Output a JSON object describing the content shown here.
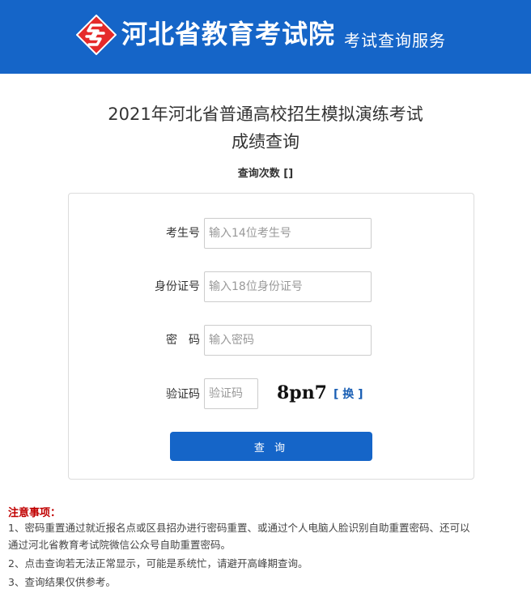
{
  "header": {
    "logo_icon": "exam-logo-icon",
    "site_name": "河北省教育考试院",
    "site_subtitle": "考试查询服务",
    "background_color": "#1565c8",
    "logo_color": "#e52a2a"
  },
  "page": {
    "title_line1": "2021年河北省普通高校招生模拟演练考试",
    "title_line2": "成绩查询",
    "query_count": "查询次数 []"
  },
  "form": {
    "exam_number": {
      "label": "考生号",
      "placeholder": "输入14位考生号",
      "value": ""
    },
    "id_number": {
      "label": "身份证号",
      "placeholder": "输入18位身份证号",
      "value": ""
    },
    "password": {
      "label": "密　码",
      "placeholder": "输入密码",
      "value": ""
    },
    "captcha": {
      "label": "验证码",
      "placeholder": "验证码",
      "value": "",
      "image_text": "8pn7",
      "refresh_open": "[",
      "refresh_label": "换",
      "refresh_close": "]"
    },
    "submit_label": "查 询",
    "accent_color": "#1565c8"
  },
  "notice": {
    "title": "注意事项：",
    "items": [
      "1、密码重置通过就近报名点或区县招办进行密码重置、或通过个人电脑人脸识别自助重置密码、还可以",
      "通过河北省教育考试院微信公众号自助重置密码。",
      "2、点击查询若无法正常显示，可能是系统忙，请避开高峰期查询。",
      "3、查询结果仅供参考。"
    ],
    "title_color": "#c00000"
  }
}
